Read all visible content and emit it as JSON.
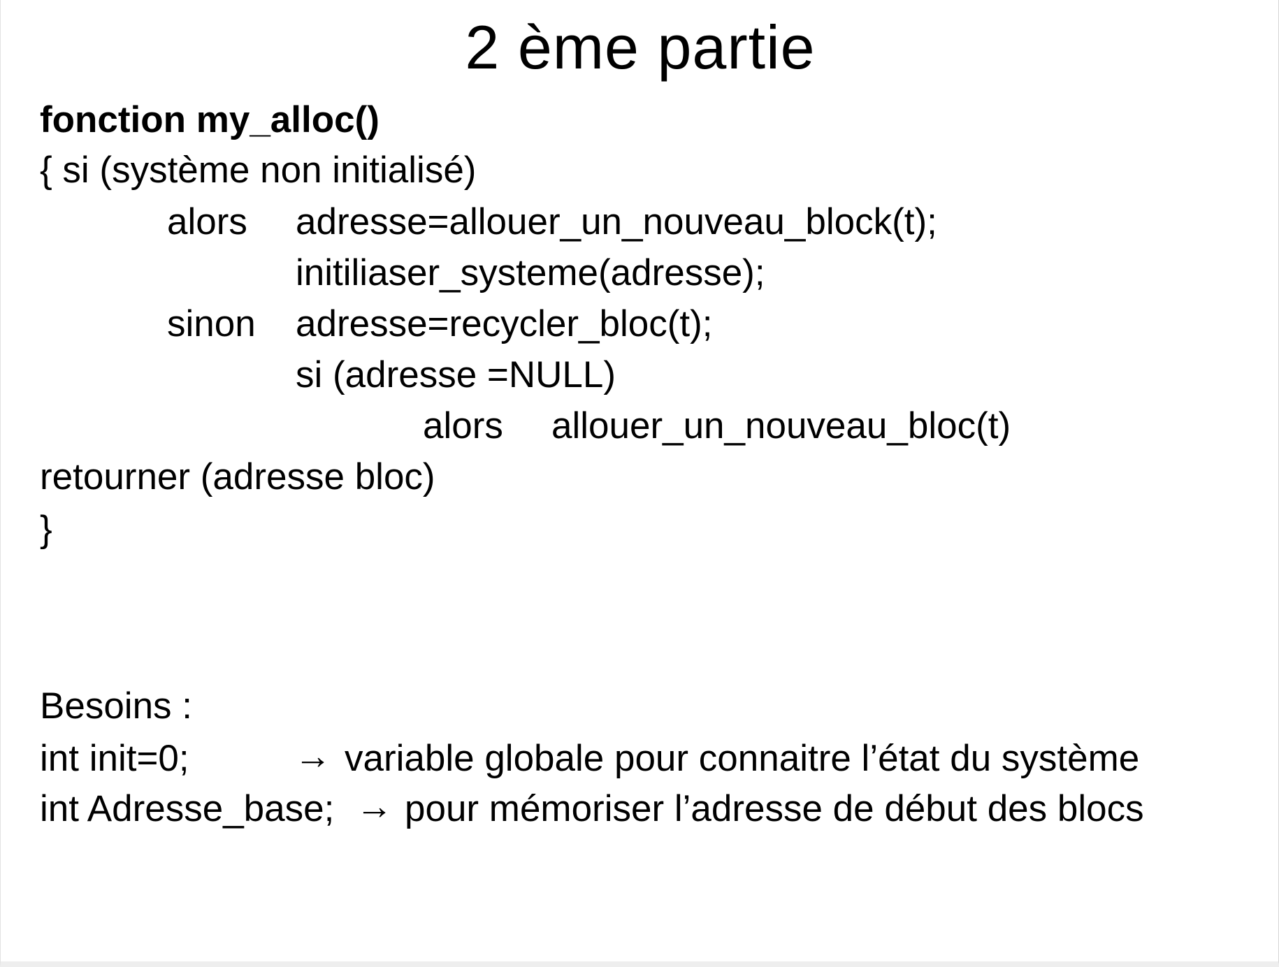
{
  "slide": {
    "title": "2 ème partie",
    "code": {
      "header": "fonction my_alloc()",
      "line1": "{ si (système non initialisé)",
      "line2_kw": "alors",
      "line2_stmt": "adresse=allouer_un_nouveau_block(t);",
      "line3_stmt": "initiliaser_systeme(adresse);",
      "line4_kw": "sinon",
      "line4_stmt": "adresse=recycler_bloc(t);",
      "line5_stmt": "si (adresse =NULL)",
      "line6_kw": "alors",
      "line6_stmt": "allouer_un_nouveau_bloc(t)",
      "line7": "retourner (adresse bloc)",
      "line8": "}"
    },
    "needs": {
      "heading": "Besoins :",
      "item1_code": "int init=0;",
      "item1_arrow": "→",
      "item1_desc": "variable globale pour connaitre l’état du système",
      "item2_code": "int Adresse_base;",
      "item2_arrow": "→",
      "item2_desc": "pour mémoriser l’adresse de début des blocs"
    }
  }
}
